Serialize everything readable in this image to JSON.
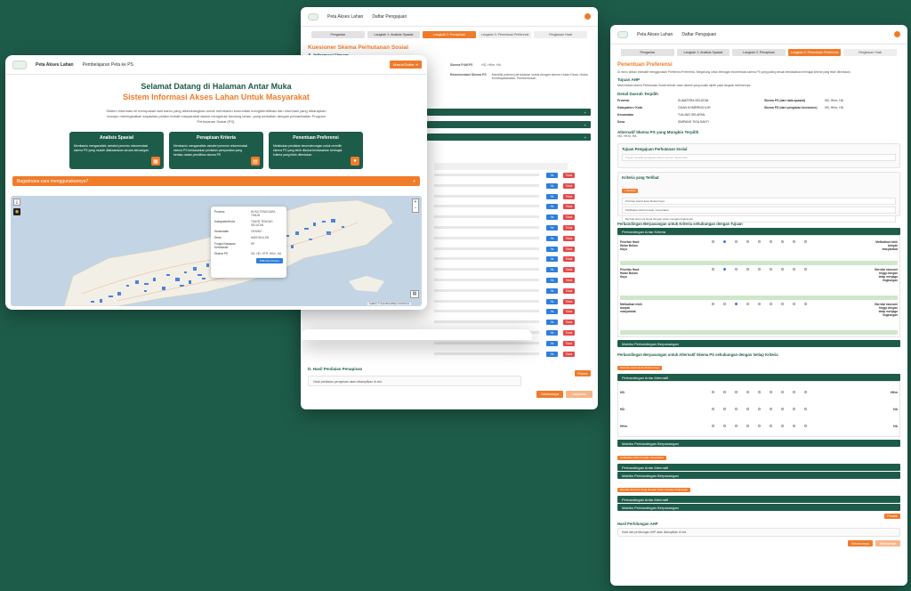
{
  "w_middle": {
    "nav": {
      "app": "Peta Akses Lahan",
      "link": "Daftar Pengajuan"
    },
    "steps": [
      "Pengantar",
      "Langkah 1: Analisis Spasial",
      "Langkah 2: Penapisan",
      "Langkah 3: Penentuan Preferensi",
      "Ringkasan Hasil"
    ],
    "title": "Kuesioner Skema Perhutanan Sosial",
    "section_a": "A. Informasi Umum",
    "skema_label": "Skema P/AKPS",
    "skema_value": "HD, HKm, HA",
    "rekom_label": "Rekomendasi Skema PS",
    "rekom_value": "Memiliki potensi perhutanan sosial dengan skema Hutan Desa, Hutan Kemasyarakatan, Pembentukan",
    "section_d": "D. Hasil Penilaian Penapisan",
    "section_d_text": "Hasil penilaian penapisan akan ditampilkan di sini.",
    "next": "Lanjutkan",
    "prev": "Sebelumnya",
    "yes": "Ya",
    "no": "Tidak",
    "proses": "Proses"
  },
  "w_right": {
    "nav": {
      "app": "Peta Akses Lahan",
      "link": "Daftar Pengajuan"
    },
    "steps": [
      "Pengantar",
      "Langkah 1: Analisis Spasial",
      "Langkah 2: Penapisan",
      "Langkah 3: Penentuan Preferensi",
      "Ringkasan Hasil"
    ],
    "title": "Penentuan Preferensi",
    "intro": "Di menu pilihan interaktif menggunakan Preferensi Preferensi. Bergabung untuk berbagai rekomendasi skema PS yang paling sesuai berdasarkan berbagai kriteria yang telah ditentukan.",
    "tujuan": "Tujuan AHP",
    "tujuan_text": "Menentukan skema Perhutanan Sosial terbaik untuk daerah yang sudah dipilih pada langkah sebelumnya.",
    "detail": "Detail Daerah Terpilih",
    "fields": [
      {
        "k": "Provinsi",
        "v": "SUMATERA SELATAN"
      },
      {
        "k": "Kabupaten / Kota",
        "v": "OGAN KOMERING ILIR"
      },
      {
        "k": "Kecamatan",
        "v": "TULUNG SELAPAN"
      },
      {
        "k": "Desa",
        "v": "SIMPANG TIGA SAKTI"
      }
    ],
    "fields2": [
      {
        "k": "Skema PS (dari data spasial)",
        "v": "HD, HKm, HA"
      },
      {
        "k": "Skema PS (dari pengisian kuesioner)",
        "v": "HD, HKm, HA"
      }
    ],
    "alt_title": "Alternatif Skema PS yang Mungkin Terpilih",
    "alt_value": "HD, HKm, HA",
    "tujuan_ps": "Tujuan Pengajuan Perhutanan Sosial",
    "tujuan_ps_ph": "Tujuan spesifik pengajuan akses sumber daya hutan",
    "kriteria": "Kriteria yang Terlibat",
    "kriteria_btn": "+ Tambah",
    "kriteria_items": [
      "Prioritas Hasil Hutan Bukan Kayu",
      "Melibatkan lebih banyak masyarakat",
      "Bernilai ekonomi tinggi dengan tetap menjaga lingkungan"
    ],
    "perb1": "Perbandingan Berpasangan untuk Kriteria sehubungan dengan Tujuan",
    "antar_kriteria": "Perbandingan Antar Kriteria",
    "rows": [
      {
        "left": "Prioritas Hasil Hutan Bukan Kayu",
        "right": "Melibatkan lebih banyak masyarakat"
      },
      {
        "left": "Prioritas Hasil Hutan Bukan Kayu",
        "right": "Bernilai ekonomi tinggi dengan tetap menjaga lingkungan"
      },
      {
        "left": "Melibatkan lebih banyak masyarakat",
        "right": "Bernilai ekonomi tinggi dengan tetap menjaga lingkungan"
      }
    ],
    "matriks": "Matriks Perbandingan Berpasangan",
    "perb2": "Perbandingan Berpasangan untuk Alternatif Skema PS sehubungan dengan Setiap Kriteria",
    "perb2_tag": "Prioritas Hasil Hutan Bukan Kayu",
    "antar_alt": "Perbandingan Antar Alternatif",
    "alt_rows": [
      {
        "l": "HD",
        "r": "HKm"
      },
      {
        "l": "HD",
        "r": "HA"
      },
      {
        "l": "HKm",
        "r": "HA"
      }
    ],
    "tag2": "Melibatkan lebih banyak masyarakat",
    "tag3": "Bernilai ekonomi tinggi dengan tetap menjaga lingkungan",
    "proses": "Proses",
    "hasil": "Hasil Perhitungan AHP",
    "hasil_text": "Hasil dari perhitungan AHP akan ditampilkan di sini.",
    "prev": "Sebelumnya",
    "next": "Selanjutnya"
  },
  "w_left": {
    "nav": {
      "app": "Peta Akses Lahan",
      "link": "Pembelajaran Peta ke PS"
    },
    "login": "Masuk/Daftar",
    "title": "Selamat Datang di Halaman Antar Muka",
    "subtitle": "Sistem Informasi Akses Lahan Untuk Masyarakat",
    "desc": "Sistem informasi ini merupakan alat bantu yang dikembangkan untuk membantu komunitas mengidentifikasi dan informasi yang diharapkan mampu meningkatkan kapasitas pelaku terkait masyarakat dalam mengelola bentang lahan, yang berkaitan dengan pemanfaatan Program Perhutanan Sosial (PS).",
    "cards": [
      {
        "t": "Analisis Spasial",
        "d": "Membantu menganalisis variabel penentu rekomendasi skema PS yang mudah dilaksanakan secara keruangan"
      },
      {
        "t": "Penapisan Kriteria",
        "d": "Membantu menganalisis variabel penentu rekomendasi skema PS berdasarkan penilaian persyaratan yang berlaku dalam pemilihan skema PS"
      },
      {
        "t": "Penentuan Preferensi",
        "d": "Melakukan penilaian kecenderungan untuk memilih skema PS yang lebih disukai berdasarkan berbagai kriteria yang telah ditentukan"
      }
    ],
    "howto": "Bagaimana cara menggunakannya?",
    "popup": [
      {
        "k": "Provinsi",
        "v": "NUSA TENGGARA TIMUR"
      },
      {
        "k": "Kabupaten/Kota",
        "v": "TIMOR TENGAH SELATAN"
      },
      {
        "k": "Kecamatan",
        "v": "OENINO"
      },
      {
        "k": "Desa",
        "v": "NAKFAKA-SN"
      },
      {
        "k": "Fungsi Kawasan Kehutanan",
        "v": "HP"
      },
      {
        "k": "Skema PS",
        "v": "HA, HD, HTR, HKm, HA"
      }
    ],
    "popup_btn": "Pilih dan Proses",
    "map_credit": "Leaflet | © OpenStreetMap contributors"
  },
  "colors": {
    "green": "#1e5c4a",
    "orange": "#f07b2a",
    "blue": "#2f7fd9",
    "red": "#e54848"
  }
}
